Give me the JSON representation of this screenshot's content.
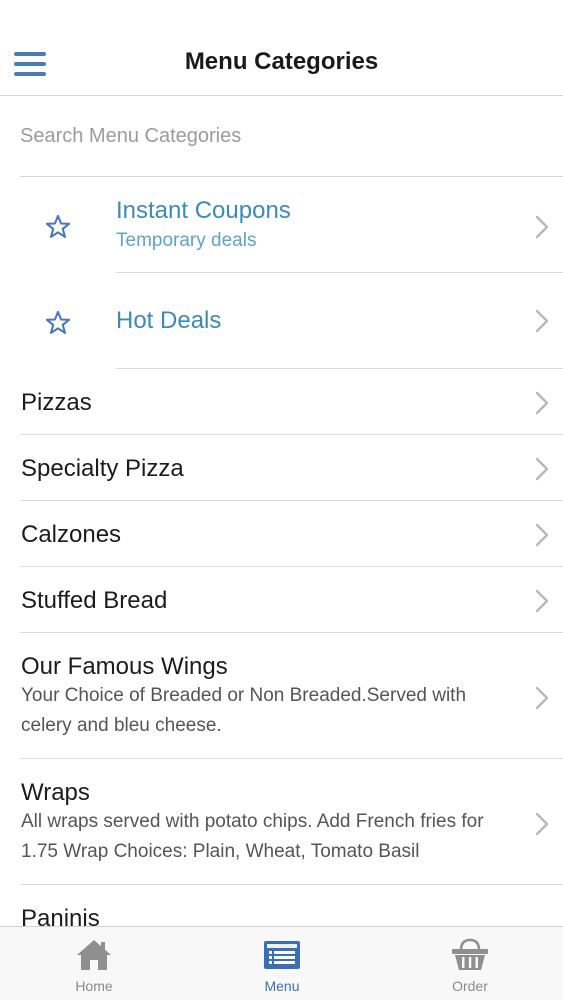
{
  "header": {
    "title": "Menu Categories",
    "menu_icon": "hamburger-menu-icon"
  },
  "search": {
    "placeholder": "Search Menu Categories",
    "value": ""
  },
  "featured": [
    {
      "title": "Instant Coupons",
      "subtitle": "Temporary deals",
      "icon": "star-icon"
    },
    {
      "title": "Hot Deals",
      "subtitle": "",
      "icon": "star-icon"
    }
  ],
  "categories": [
    {
      "title": "Pizzas",
      "description": ""
    },
    {
      "title": "Specialty Pizza",
      "description": ""
    },
    {
      "title": "Calzones",
      "description": ""
    },
    {
      "title": "Stuffed Bread",
      "description": ""
    },
    {
      "title": "Our Famous Wings",
      "description": "Your Choice of Breaded or Non Breaded.Served with celery and bleu cheese."
    },
    {
      "title": "Wraps",
      "description": "All wraps served with potato chips. Add French fries for 1.75 Wrap Choices: Plain, Wheat, Tomato Basil"
    },
    {
      "title": "Paninis",
      "description": ""
    }
  ],
  "tabbar": {
    "tabs": [
      {
        "label": "Home",
        "icon": "home-icon",
        "active": false
      },
      {
        "label": "Menu",
        "icon": "menu-list-icon",
        "active": true
      },
      {
        "label": "Order",
        "icon": "basket-icon",
        "active": false
      }
    ]
  },
  "colors": {
    "accent_blue": "#3a8bb8",
    "icon_blue": "#4a7ab8",
    "tab_active": "#3b6fb5",
    "tab_inactive": "#8a8a8a",
    "separator": "#dcdcdc"
  }
}
